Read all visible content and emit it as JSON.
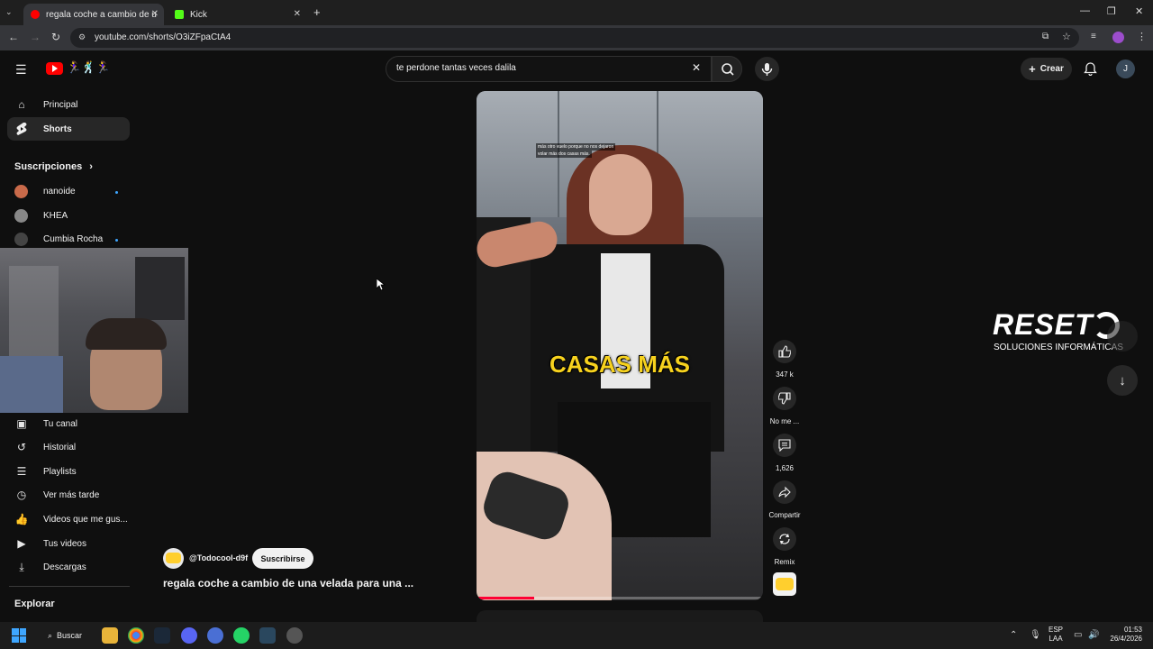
{
  "browser": {
    "tabs": [
      {
        "title": "regala coche a cambio de u",
        "active": true
      },
      {
        "title": "Kick",
        "active": false
      }
    ],
    "new_tab_symbol": "+",
    "url": "youtube.com/shorts/O3iZFpaCtA4"
  },
  "header": {
    "logo_text": "🏃‍♀️🕺🏃‍♀️",
    "search_value": "te perdone tantas veces dalila",
    "create_label": "Crear",
    "avatar_letter": "J"
  },
  "sidebar": {
    "main": [
      {
        "label": "Principal",
        "icon": "home-icon"
      },
      {
        "label": "Shorts",
        "icon": "shorts-icon",
        "active": true
      }
    ],
    "subscriptions_title": "Suscripciones",
    "subscriptions": [
      {
        "label": "nanoide",
        "new": true
      },
      {
        "label": "KHEA",
        "new": false
      },
      {
        "label": "Cumbia Rocha",
        "new": true
      }
    ],
    "you": [
      {
        "label": "Tu canal",
        "icon": "channel-icon"
      },
      {
        "label": "Historial",
        "icon": "history-icon"
      },
      {
        "label": "Playlists",
        "icon": "playlists-icon"
      },
      {
        "label": "Ver más tarde",
        "icon": "clock-icon"
      },
      {
        "label": "Videos que me gus...",
        "icon": "thumb-up-icon"
      },
      {
        "label": "Tus videos",
        "icon": "video-icon"
      },
      {
        "label": "Descargas",
        "icon": "download-icon"
      }
    ],
    "explore_title": "Explorar"
  },
  "short": {
    "caption_small_1": "más otro vuelo porque no nos dejaron",
    "caption_small_2": "volar más dos casas más.",
    "caption_big": "CASAS MÁS",
    "channel": "@Todocool-d9f",
    "subscribe_label": "Suscribirse",
    "title": "regala coche a cambio de una velada para una ...",
    "progress_fraction": 0.2
  },
  "actions": {
    "like_count": "347 k",
    "dislike_label": "No me ...",
    "comments_count": "1,626",
    "share_label": "Compartir",
    "remix_label": "Remix"
  },
  "overlay": {
    "brand": "RESET",
    "brand_sub": "SOLUCIONES INFORMÁTICAS"
  },
  "taskbar": {
    "search_label": "Buscar",
    "lang_1": "ESP",
    "lang_2": "LAA",
    "time": "01:53",
    "date": "26/4/2026"
  }
}
